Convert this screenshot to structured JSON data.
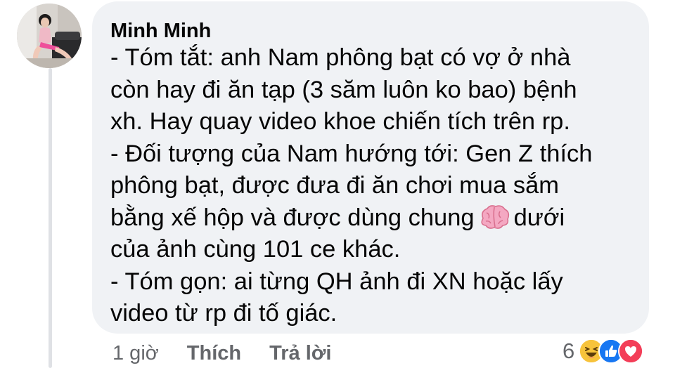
{
  "comment": {
    "author": "Minh Minh",
    "lines": [
      "- Tóm tắt: anh Nam phông bạt có vợ ở nhà",
      "còn hay đi ăn tạp (3 săm luôn ko bao) bệnh",
      "xh. Hay quay video khoe chiến tích trên rp.",
      "- Đối tượng của Nam hướng tới: Gen Z thích",
      "phông bạt, được đưa đi ăn chơi mua sắm",
      "của ảnh cùng 101 ce khác.",
      "- Tóm gọn: ai từng QH ảnh đi XN hoặc lấy",
      "video từ rp đi tố giác."
    ],
    "line6_before_emoji": "bằng xế hộp và được dùng chung",
    "line6_after_emoji": "dưới",
    "inline_emoji": "brain-icon"
  },
  "footer": {
    "time": "1 giờ",
    "like_label": "Thích",
    "reply_label": "Trả lời",
    "reaction_count": "6",
    "reactions": [
      "haha-icon",
      "like-icon",
      "love-icon"
    ]
  },
  "colors": {
    "bubble": "#f0f2f5",
    "text": "#050505",
    "meta": "#65676b",
    "like": "#1877f2",
    "love": "#f33e58",
    "haha": "#f7b125"
  }
}
